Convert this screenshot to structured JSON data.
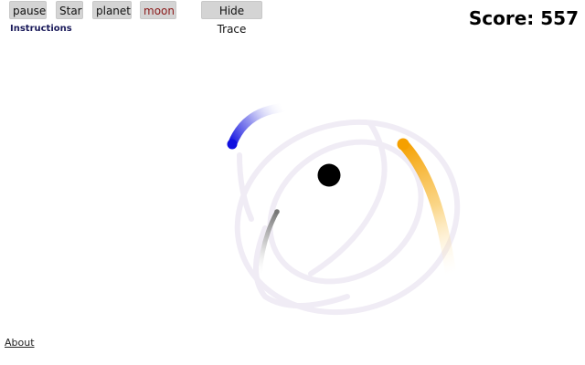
{
  "toolbar": {
    "pause_label": "pause",
    "star_label": "Star",
    "planet_label": "planet",
    "moon_label": "moon",
    "trace_label": "Hide Trace"
  },
  "instructions_label": "Instructions",
  "score_text": "Score: 557",
  "about_label": "About",
  "colors": {
    "button_bg": "#d4d4d4",
    "button_text": "#111111",
    "moon_text": "#8b1a1a",
    "star": "#000000",
    "planet_blue": "#1010e0",
    "planet_orange": "#f5a000",
    "planet_gray": "#808080",
    "trace_faint": "#ebe6f2"
  },
  "bodies": [
    {
      "name": "star",
      "color": "#000000"
    },
    {
      "name": "blue-planet",
      "color": "#1010e0"
    },
    {
      "name": "orange-planet",
      "color": "#f5a000"
    },
    {
      "name": "gray-moon",
      "color": "#808080"
    }
  ]
}
